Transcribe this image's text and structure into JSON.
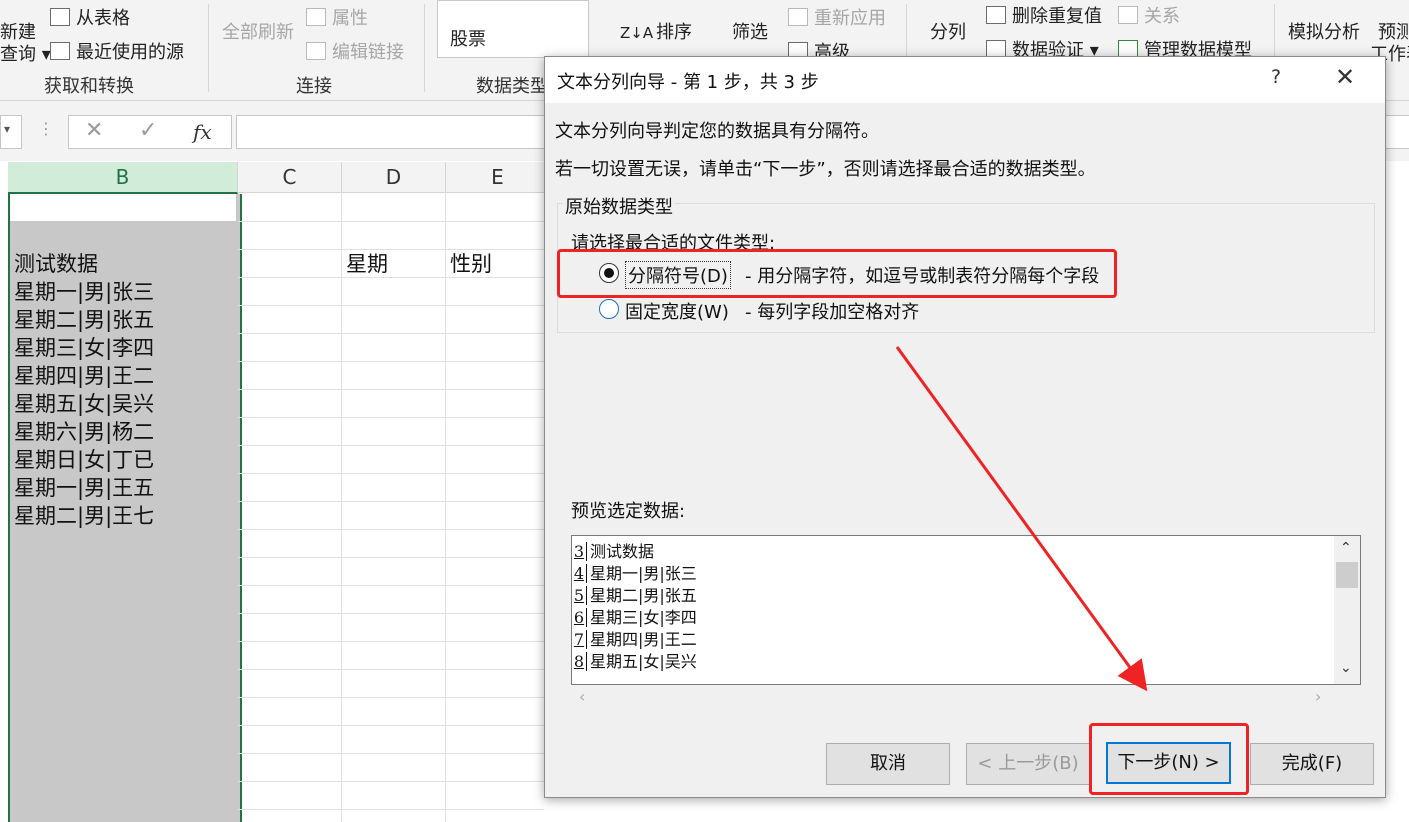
{
  "ribbon": {
    "new_query_line1": "新建",
    "new_query_line2": "查询",
    "from_table": "从表格",
    "recent_sources": "最近使用的源",
    "group_get_transform": "获取和转换",
    "refresh_all": "全部刷新",
    "properties": "属性",
    "edit_links": "编辑链接",
    "group_connections": "连接",
    "stocks": "股票",
    "group_data_types": "数据类型",
    "sort": "排序",
    "filter": "筛选",
    "reapply": "重新应用",
    "advanced": "高级",
    "text_to_columns": "分列",
    "remove_duplicates": "删除重复值",
    "relationships": "关系",
    "data_validation": "数据验证",
    "manage_data_model": "管理数据模型",
    "what_if": "模拟分析",
    "forecast_line1": "预测",
    "forecast_line2": "工作表"
  },
  "formula_bar": {
    "fx": "fx",
    "cancel": "✕",
    "enter": "✓"
  },
  "sheet": {
    "columns": [
      "B",
      "C",
      "D",
      "E"
    ],
    "cells": {
      "b3": "测试数据",
      "b4": "星期一|男|张三",
      "b5": "星期二|男|张五",
      "b6": "星期三|女|李四",
      "b7": "星期四|男|王二",
      "b8": "星期五|女|吴兴",
      "b9": "星期六|男|杨二",
      "b10": "星期日|女|丁已",
      "b11": "星期一|男|王五",
      "b12": "星期二|男|王七",
      "d3": "星期",
      "e3": "性别"
    }
  },
  "dialog": {
    "title": "文本分列向导 - 第 1 步，共 3 步",
    "help": "?",
    "close": "✕",
    "line1": "文本分列向导判定您的数据具有分隔符。",
    "line2": "若一切设置无误，请单击“下一步”，否则请选择最合适的数据类型。",
    "group_label": "原始数据类型",
    "choose_label": "请选择最合适的文件类型:",
    "option_delimited": "分隔符号(D)",
    "option_delimited_desc": "- 用分隔字符，如逗号或制表符分隔每个字段",
    "option_fixed": "固定宽度(W)",
    "option_fixed_desc": "- 每列字段加空格对齐",
    "preview_label": "预览选定数据:",
    "preview_rows": [
      {
        "n": "3",
        "text": "测试数据"
      },
      {
        "n": "4",
        "text": "星期一|男|张三"
      },
      {
        "n": "5",
        "text": "星期二|男|张五"
      },
      {
        "n": "6",
        "text": "星期三|女|李四"
      },
      {
        "n": "7",
        "text": "星期四|男|王二"
      },
      {
        "n": "8",
        "text": "星期五|女|吴兴"
      }
    ],
    "btn_cancel": "取消",
    "btn_back": "< 上一步(B)",
    "btn_next": "下一步(N) >",
    "btn_finish": "完成(F)"
  },
  "colors": {
    "annotation_red": "#ef2323",
    "excel_green": "#217346",
    "selected_column": "#c8c8c8"
  }
}
